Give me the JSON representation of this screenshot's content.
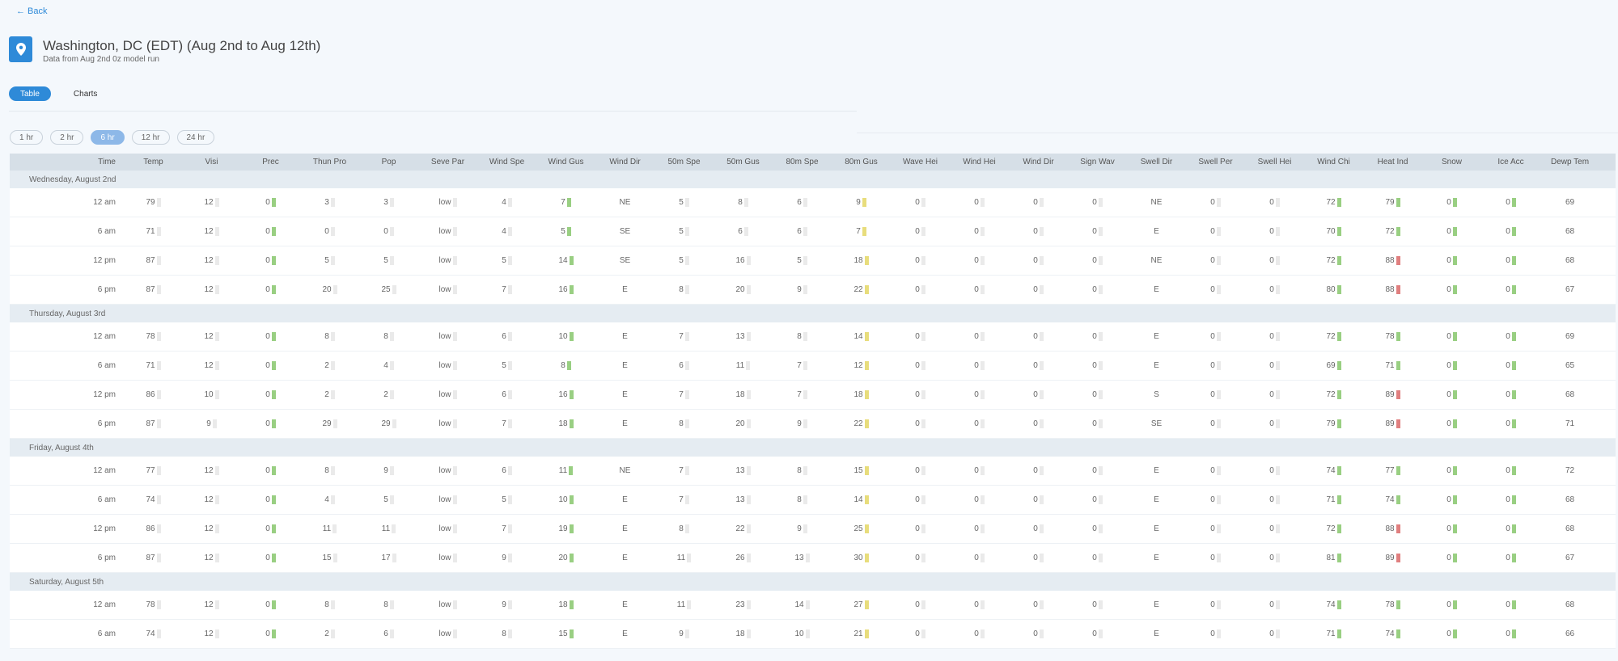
{
  "back_label": "Back",
  "title": "Washington, DC (EDT) (Aug 2nd to Aug 12th)",
  "subtitle": "Data from Aug 2nd 0z model run",
  "view_tabs": [
    "Table",
    "Charts"
  ],
  "active_view": 0,
  "intervals": [
    "1 hr",
    "2 hr",
    "6 hr",
    "12 hr",
    "24 hr"
  ],
  "active_interval": 2,
  "columns": [
    "Time",
    "Temp",
    "Visi",
    "Prec",
    "Thun Pro",
    "Pop",
    "Seve Par",
    "Wind Spe",
    "Wind Gus",
    "Wind Dir",
    "50m Spe",
    "50m Gus",
    "80m Spe",
    "80m Gus",
    "Wave Hei",
    "Wind Hei",
    "Wind Dir",
    "Sign Wav",
    "Swell Dir",
    "Swell Per",
    "Swell Hei",
    "Wind Chi",
    "Heat Ind",
    "Snow",
    "Ice Acc",
    "Dewp Tem"
  ],
  "colors": {
    "accent": "#2e8ad8",
    "green": "#99cf82",
    "yellow": "#e8dd7c",
    "red": "#e07f7f"
  },
  "days": [
    {
      "label": "Wednesday, August 2nd",
      "rows": [
        [
          "12 am",
          "79",
          "12",
          "0",
          "3",
          "3",
          "low",
          "4",
          "7",
          "NE",
          "5",
          "8",
          "6",
          "9",
          "0",
          "0",
          "0",
          "0",
          "NE",
          "0",
          "0",
          "72",
          "79",
          "0",
          "0",
          "69"
        ],
        [
          "6 am",
          "71",
          "12",
          "0",
          "0",
          "0",
          "low",
          "4",
          "5",
          "SE",
          "5",
          "6",
          "6",
          "7",
          "0",
          "0",
          "0",
          "0",
          "E",
          "0",
          "0",
          "70",
          "72",
          "0",
          "0",
          "68"
        ],
        [
          "12 pm",
          "87",
          "12",
          "0",
          "5",
          "5",
          "low",
          "5",
          "14",
          "SE",
          "5",
          "16",
          "5",
          "18",
          "0",
          "0",
          "0",
          "0",
          "NE",
          "0",
          "0",
          "72",
          "88",
          "0",
          "0",
          "68"
        ],
        [
          "6 pm",
          "87",
          "12",
          "0",
          "20",
          "25",
          "low",
          "7",
          "16",
          "E",
          "8",
          "20",
          "9",
          "22",
          "0",
          "0",
          "0",
          "0",
          "E",
          "0",
          "0",
          "80",
          "88",
          "0",
          "0",
          "67"
        ]
      ]
    },
    {
      "label": "Thursday, August 3rd",
      "rows": [
        [
          "12 am",
          "78",
          "12",
          "0",
          "8",
          "8",
          "low",
          "6",
          "10",
          "E",
          "7",
          "13",
          "8",
          "14",
          "0",
          "0",
          "0",
          "0",
          "E",
          "0",
          "0",
          "72",
          "78",
          "0",
          "0",
          "69"
        ],
        [
          "6 am",
          "71",
          "12",
          "0",
          "2",
          "4",
          "low",
          "5",
          "8",
          "E",
          "6",
          "11",
          "7",
          "12",
          "0",
          "0",
          "0",
          "0",
          "E",
          "0",
          "0",
          "69",
          "71",
          "0",
          "0",
          "65"
        ],
        [
          "12 pm",
          "86",
          "10",
          "0",
          "2",
          "2",
          "low",
          "6",
          "16",
          "E",
          "7",
          "18",
          "7",
          "18",
          "0",
          "0",
          "0",
          "0",
          "S",
          "0",
          "0",
          "72",
          "89",
          "0",
          "0",
          "68"
        ],
        [
          "6 pm",
          "87",
          "9",
          "0",
          "29",
          "29",
          "low",
          "7",
          "18",
          "E",
          "8",
          "20",
          "9",
          "22",
          "0",
          "0",
          "0",
          "0",
          "SE",
          "0",
          "0",
          "79",
          "89",
          "0",
          "0",
          "71"
        ]
      ]
    },
    {
      "label": "Friday, August 4th",
      "rows": [
        [
          "12 am",
          "77",
          "12",
          "0",
          "8",
          "9",
          "low",
          "6",
          "11",
          "NE",
          "7",
          "13",
          "8",
          "15",
          "0",
          "0",
          "0",
          "0",
          "E",
          "0",
          "0",
          "74",
          "77",
          "0",
          "0",
          "72"
        ],
        [
          "6 am",
          "74",
          "12",
          "0",
          "4",
          "5",
          "low",
          "5",
          "10",
          "E",
          "7",
          "13",
          "8",
          "14",
          "0",
          "0",
          "0",
          "0",
          "E",
          "0",
          "0",
          "71",
          "74",
          "0",
          "0",
          "68"
        ],
        [
          "12 pm",
          "86",
          "12",
          "0",
          "11",
          "11",
          "low",
          "7",
          "19",
          "E",
          "8",
          "22",
          "9",
          "25",
          "0",
          "0",
          "0",
          "0",
          "E",
          "0",
          "0",
          "72",
          "88",
          "0",
          "0",
          "68"
        ],
        [
          "6 pm",
          "87",
          "12",
          "0",
          "15",
          "17",
          "low",
          "9",
          "20",
          "E",
          "11",
          "26",
          "13",
          "30",
          "0",
          "0",
          "0",
          "0",
          "E",
          "0",
          "0",
          "81",
          "89",
          "0",
          "0",
          "67"
        ]
      ]
    },
    {
      "label": "Saturday, August 5th",
      "rows": [
        [
          "12 am",
          "78",
          "12",
          "0",
          "8",
          "8",
          "low",
          "9",
          "18",
          "E",
          "11",
          "23",
          "14",
          "27",
          "0",
          "0",
          "0",
          "0",
          "E",
          "0",
          "0",
          "74",
          "78",
          "0",
          "0",
          "68"
        ],
        [
          "6 am",
          "74",
          "12",
          "0",
          "2",
          "6",
          "low",
          "8",
          "15",
          "E",
          "9",
          "18",
          "10",
          "21",
          "0",
          "0",
          "0",
          "0",
          "E",
          "0",
          "0",
          "71",
          "74",
          "0",
          "0",
          "66"
        ]
      ]
    }
  ]
}
